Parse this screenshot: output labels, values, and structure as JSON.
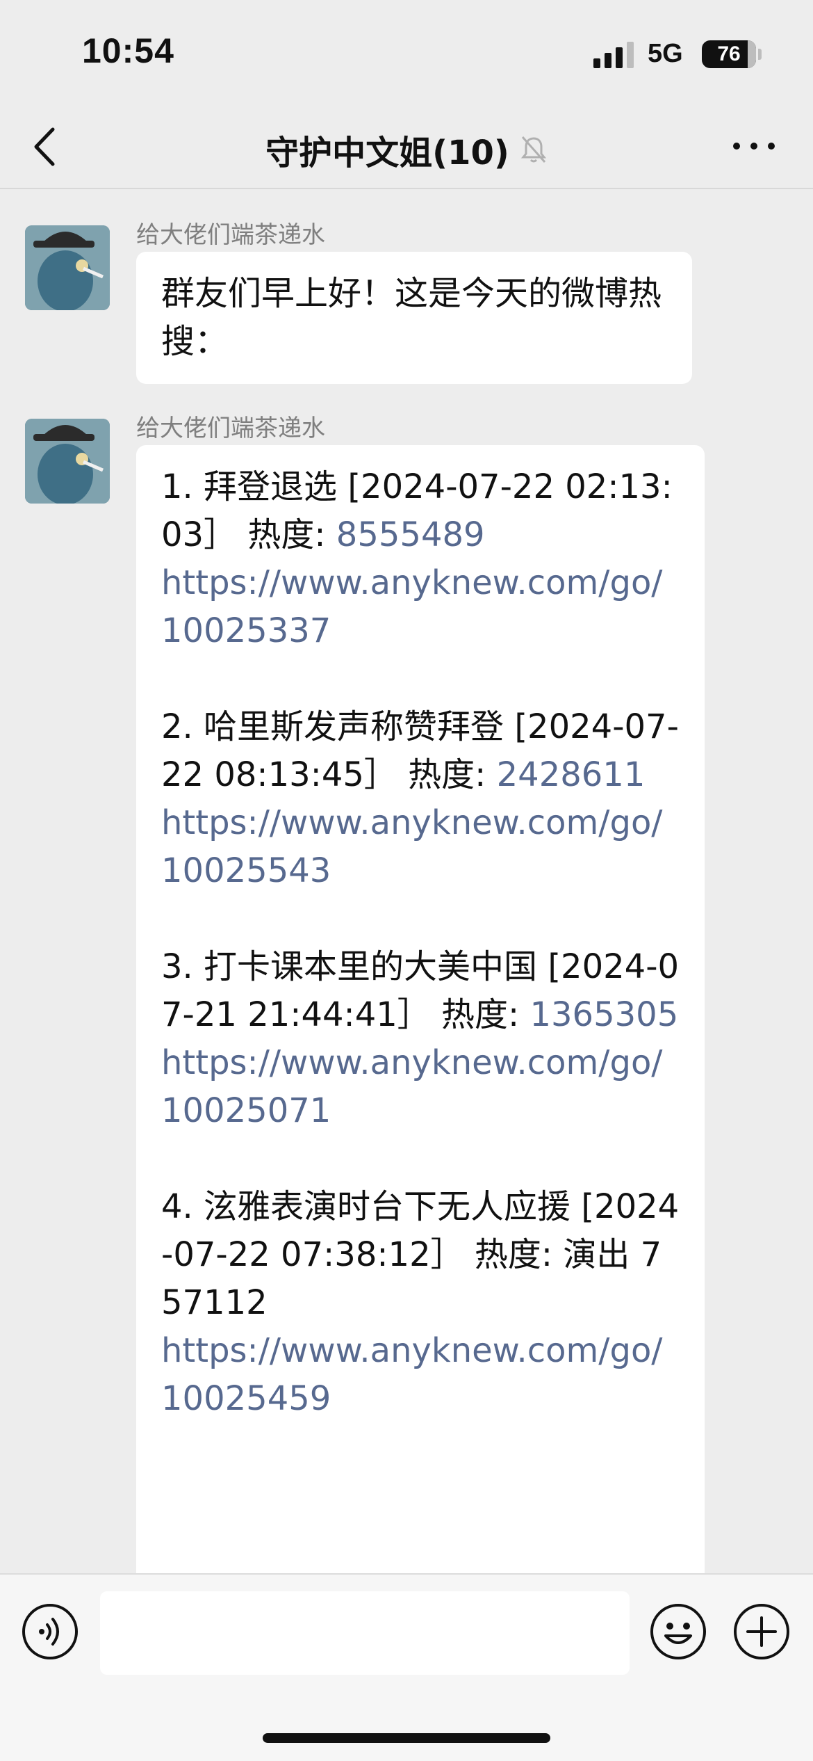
{
  "status_bar": {
    "time": "10:54",
    "network": "5G",
    "battery": "76"
  },
  "nav": {
    "title": "守护中文姐(10)",
    "back_icon": "chevron-left-icon",
    "mute_icon": "bell-slash-icon",
    "more_icon": "more-dots-icon"
  },
  "messages": [
    {
      "sender": "给大佬们端茶递水",
      "text": "群友们早上好！这是今天的微博热搜："
    },
    {
      "sender": "给大佬们端茶递水",
      "items": [
        {
          "prefix": "1. 拜登退选 [2024-07-22 02:13:03］ 热度: ",
          "heat": "8555489",
          "link": "https://www.anyknew.com/go/10025337"
        },
        {
          "prefix": "2. 哈里斯发声称赞拜登 [2024-07-22 08:13:45］ 热度: ",
          "heat": "2428611",
          "link": "https://www.anyknew.com/go/10025543"
        },
        {
          "prefix": "3. 打卡课本里的大美中国 [2024-07-21 21:44:41］ 热度: ",
          "heat": "1365305",
          "link": "https://www.anyknew.com/go/10025071"
        },
        {
          "prefix": "4. 泫雅表演时台下无人应援 [2024-07-22 07:38:12］ 热度: 演出 757112",
          "heat": "",
          "link": "https://www.anyknew.com/go/10025459"
        }
      ]
    }
  ],
  "input_bar": {
    "voice_icon": "voice-icon",
    "emoji_icon": "emoji-icon",
    "plus_icon": "plus-circle-icon",
    "input_value": ""
  },
  "colors": {
    "background": "#ededed",
    "link": "#57698f",
    "bubble": "#ffffff"
  }
}
